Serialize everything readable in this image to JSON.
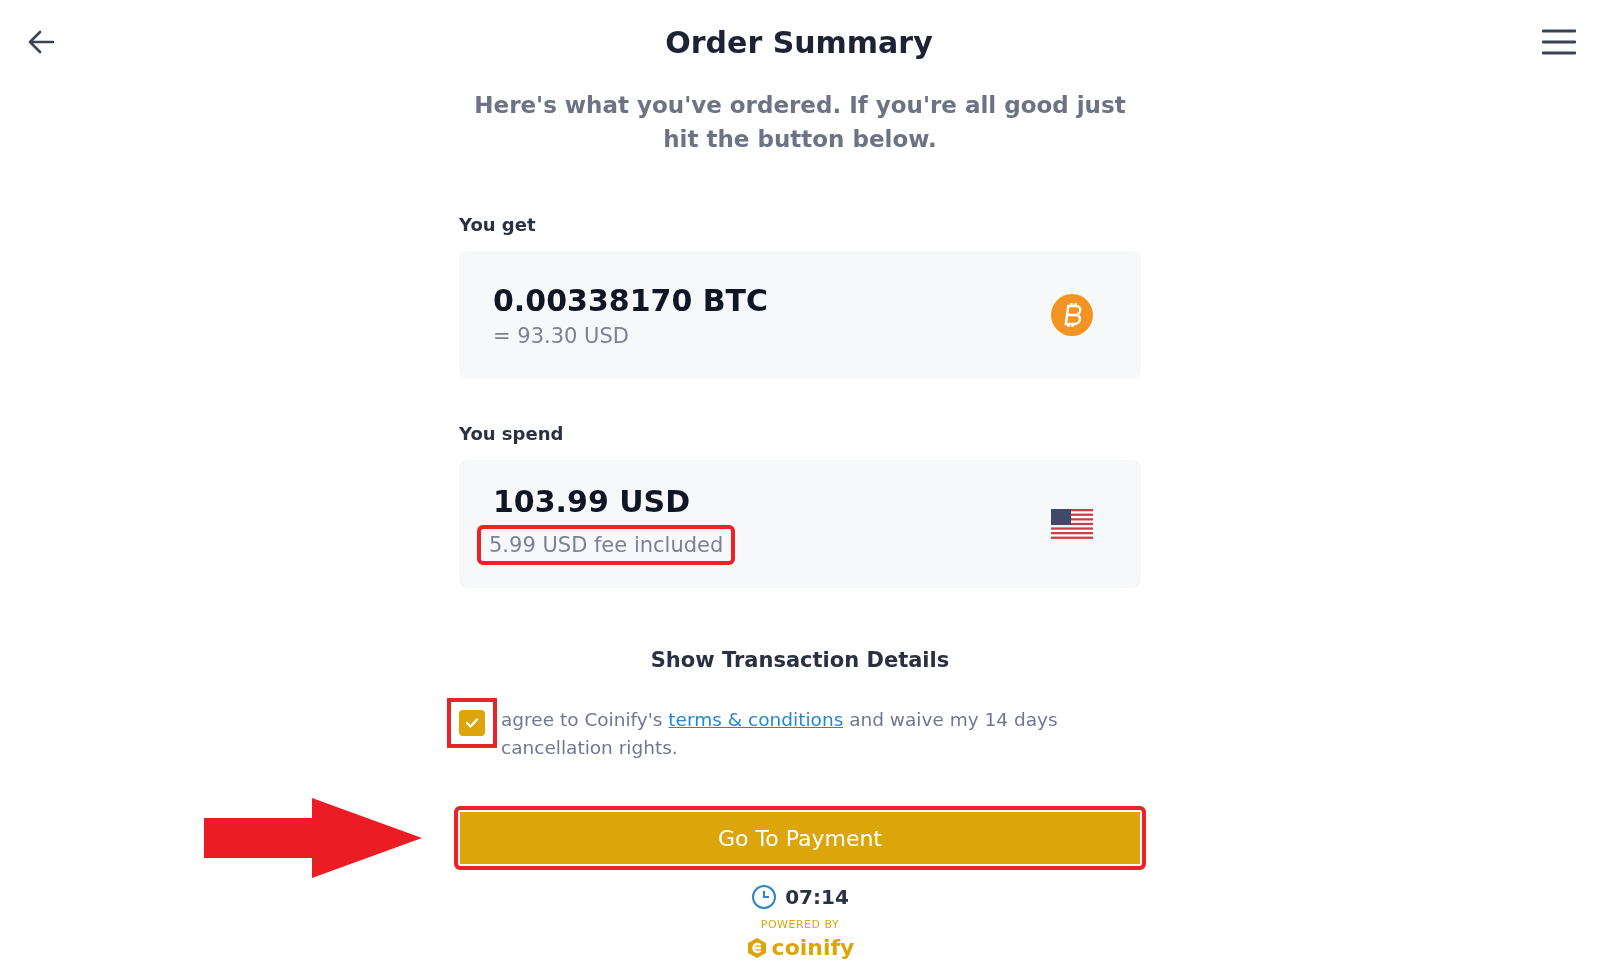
{
  "header": {
    "title": "Order Summary"
  },
  "subtitle": "Here's what you've ordered. If you're all good just hit the button below.",
  "you_get": {
    "label": "You get",
    "amount": "0.00338170 BTC",
    "fiat_equivalent": "= 93.30 USD"
  },
  "you_spend": {
    "label": "You spend",
    "amount": "103.99 USD",
    "fee_note": "5.99 USD fee included"
  },
  "details_toggle": "Show Transaction Details",
  "agreement": {
    "checked": true,
    "text_before": "agree to Coinify's",
    "link": "terms & conditions",
    "text_after": "and waive my 14 days cancellation rights."
  },
  "primary_button": "Go To Payment",
  "timer": "07:14",
  "footer": {
    "powered_by": "POWERED BY",
    "brand": "coinify"
  }
}
